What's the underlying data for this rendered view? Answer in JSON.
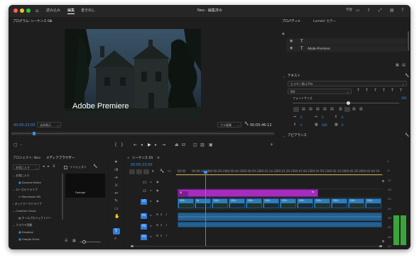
{
  "titlebar": {
    "tabs": [
      "読み込み",
      "編集",
      "書き出し"
    ],
    "active_tab": "編集",
    "title": "Neo - 編集済み",
    "workspace": "学習"
  },
  "program_monitor": {
    "tab": "プログラム: シーケンス 01",
    "overlay_title": "Adobe Premiere",
    "timecode_current": "00:00:23:00",
    "fit": "全体表示",
    "quality": "フル画質",
    "timecode_duration": "00:05:46:12"
  },
  "properties_panel": {
    "tabs": [
      "プロパティ",
      "Lumetri カラー"
    ],
    "layers": [
      {
        "icon": "T",
        "label": ""
      },
      {
        "icon": "T",
        "label": "Adobe Premiere"
      }
    ],
    "text_section": "テキスト",
    "font": "ヒラギノ角ゴ Pro",
    "font_style": "W4",
    "font_size_label": "フォントサイズ",
    "font_size_value": "185",
    "fields": [
      "0",
      "0",
      "0",
      "0",
      "400",
      "0"
    ],
    "appearance_section": "アピアランス",
    "colors": {
      "accent": "#2d7de0",
      "text": "#b8b8b8"
    }
  },
  "project_panel": {
    "tabs": [
      "プロジェクト: Neo",
      "メディアブラウザー"
    ],
    "favorites": "お気に入り",
    "ingest": "インジェスト",
    "tree": [
      {
        "label": "お気に入り",
        "level": 0
      },
      {
        "label": "Sample Media",
        "level": 1
      },
      {
        "label": "ローカルドライブ",
        "level": 0
      },
      {
        "label": "Macintosh HD",
        "level": 1
      },
      {
        "label": "ネットワークドライブ",
        "level": 0
      },
      {
        "label": "Creative Cloud",
        "level": 0
      },
      {
        "label": "チームプロジェクトバー",
        "level": 1
      },
      {
        "label": "クラウド同期",
        "level": 0
      },
      {
        "label": "Dropbox",
        "level": 1
      },
      {
        "label": "Google Drive",
        "level": 1
      }
    ],
    "preview_label": "Footage"
  },
  "timeline": {
    "tab": "シーケンス 01",
    "timecode": "00:00:23:00",
    "ruler": [
      "00:00",
      "00:00:14:23",
      "00:00:29:23",
      "00:00:44:22",
      "00:00:59:22",
      "00:01:14:22",
      "00:01:29:21",
      "00:01:44:21",
      "00:01:59:21",
      "00:02:14:20",
      "00:02:29:20",
      "00:02:44:19"
    ],
    "video_tracks": [
      "V3",
      "V2",
      "V1"
    ],
    "audio_tracks": [
      "A1",
      "A2",
      "A3"
    ],
    "clip_labels": [
      "C00..",
      "fx",
      "C00..",
      "C00..",
      "C00..",
      "C00..",
      "C00..",
      "C00..",
      "C00..",
      "C00..",
      "C00..",
      "C00.."
    ],
    "text_clip_label": "Ai"
  },
  "audio_meter": {
    "ticks": [
      "0",
      "-6",
      "-12",
      "-18",
      "-24",
      "-30",
      "-36",
      "-42",
      "-48",
      "-54"
    ],
    "level_fraction": 0.35
  }
}
